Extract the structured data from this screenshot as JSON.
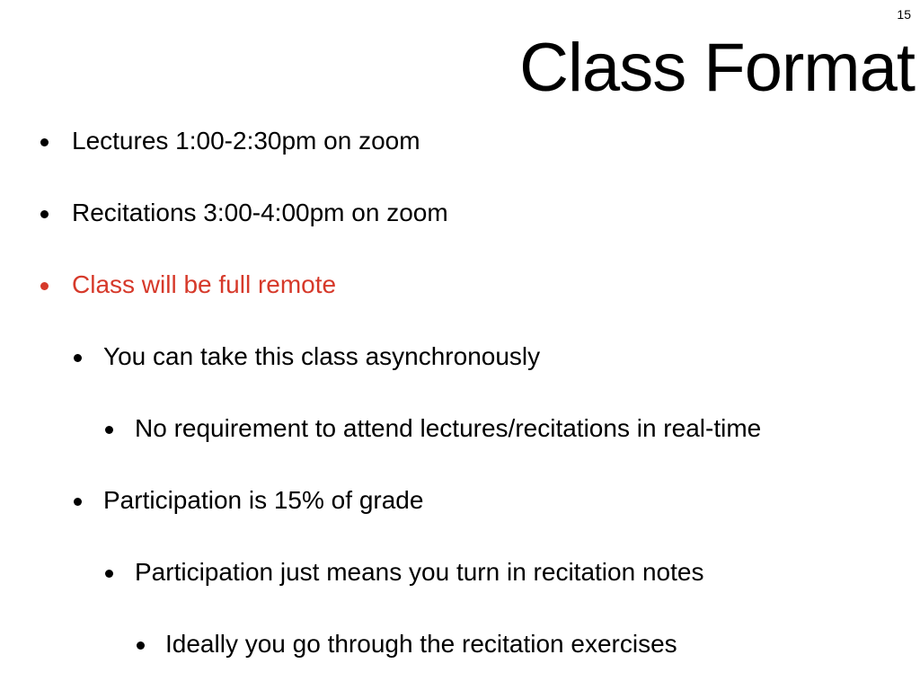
{
  "slide": {
    "number": "15",
    "title": "Class Format",
    "accent_color": "#d6392a",
    "bullets": [
      {
        "text": "Lectures 1:00-2:30pm on zoom",
        "level": 1
      },
      {
        "text": "Recitations 3:00-4:00pm on zoom",
        "level": 1
      },
      {
        "text": "Class will be full remote",
        "level": 1,
        "color": "#d6392a"
      },
      {
        "text": "You can take this class asynchronously",
        "level": 2
      },
      {
        "text": "No requirement to attend lectures/recitations in real-time",
        "level": 3
      },
      {
        "text": "Participation is 15% of grade",
        "level": 2
      },
      {
        "text": "Participation just means you turn in recitation notes",
        "level": 3
      },
      {
        "text": "Ideally you go through the recitation exercises",
        "level": 4
      }
    ]
  }
}
